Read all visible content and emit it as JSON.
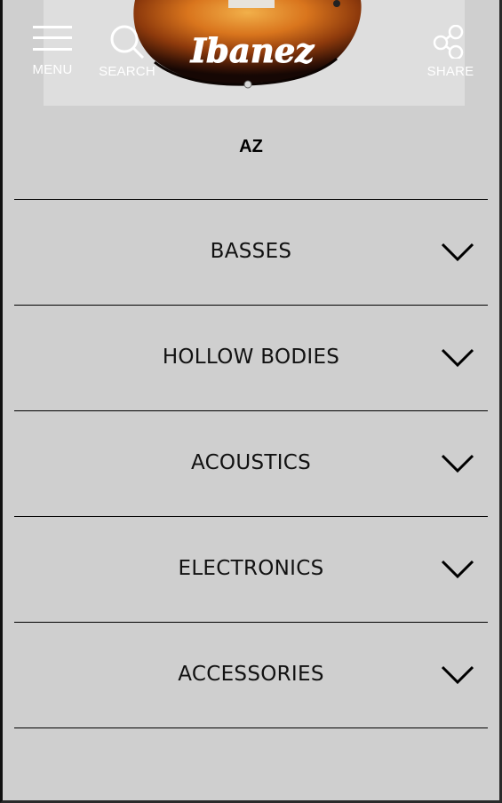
{
  "header": {
    "menu_label": "MENU",
    "search_label": "SEARCH",
    "share_label": "SHARE",
    "brand": "Ibanez"
  },
  "icons": {
    "menu": "hamburger-icon",
    "search": "search-icon",
    "share": "share-icon",
    "expand": "chevron-down-icon"
  },
  "page": {
    "title": "AZ"
  },
  "categories": [
    {
      "label": "BASSES"
    },
    {
      "label": "HOLLOW BODIES"
    },
    {
      "label": "ACOUSTICS"
    },
    {
      "label": "ELECTRONICS"
    },
    {
      "label": "ACCESSORIES"
    }
  ],
  "colors": {
    "background": "#cfcfcf",
    "hero_background": "#dedede",
    "header_text": "#ffffff",
    "divider": "#000000"
  }
}
